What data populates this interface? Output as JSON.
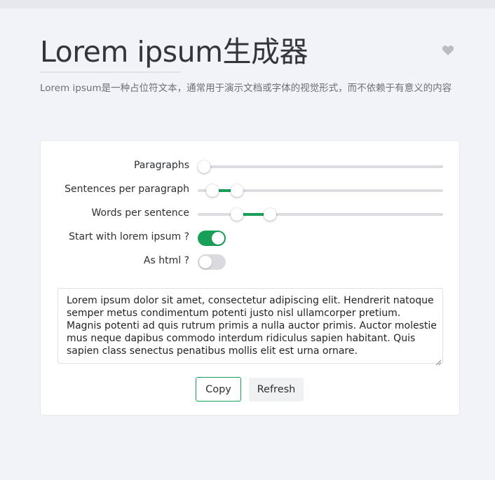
{
  "header": {
    "title": "Lorem ipsum生成器",
    "description": "Lorem ipsum是一种占位符文本，通常用于演示文档或字体的视觉形式，而不依赖于有意义的内容"
  },
  "form": {
    "paragraphs": {
      "label": "Paragraphs",
      "range": [
        1,
        1
      ]
    },
    "sentences": {
      "label": "Sentences per paragraph",
      "range": [
        3,
        8
      ]
    },
    "words": {
      "label": "Words per sentence",
      "range": [
        8,
        15
      ]
    },
    "start_with_lorem": {
      "label": "Start with lorem ipsum ?",
      "checked": true
    },
    "as_html": {
      "label": "As html ?",
      "checked": false
    }
  },
  "output": {
    "text": "Lorem ipsum dolor sit amet, consectetur adipiscing elit. Hendrerit natoque semper metus condimentum potenti justo nisl ullamcorper pretium. Magnis potenti ad quis rutrum primis a nulla auctor primis. Auctor molestie mus neque dapibus commodo interdum ridiculus sapien habitant. Quis sapien class senectus penatibus mollis elit est urna ornare."
  },
  "actions": {
    "copy_label": "Copy",
    "refresh_label": "Refresh"
  },
  "colors": {
    "accent": "#18a058",
    "background": "#f1f3f7",
    "card": "#ffffff"
  },
  "icons": {
    "favorite": "heart-icon"
  }
}
